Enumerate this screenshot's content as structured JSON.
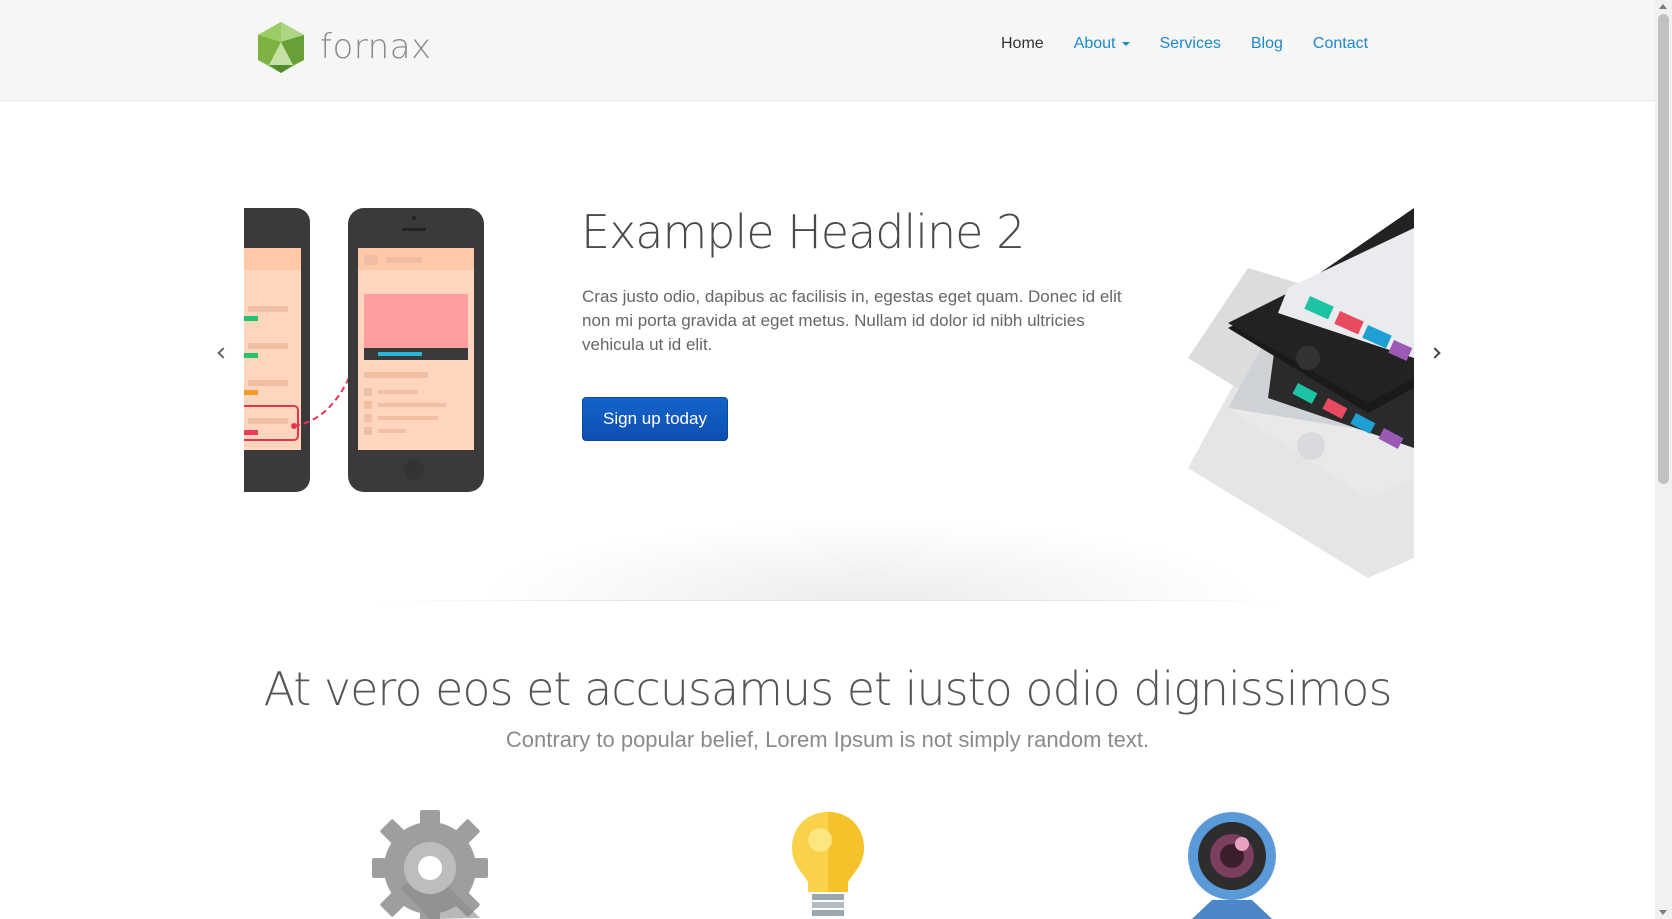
{
  "brand": {
    "name": "fornax"
  },
  "nav": {
    "items": [
      {
        "label": "Home",
        "active": true
      },
      {
        "label": "About",
        "dropdown": true
      },
      {
        "label": "Services"
      },
      {
        "label": "Blog"
      },
      {
        "label": "Contact"
      }
    ]
  },
  "hero": {
    "headline": "Example Headline 2",
    "lead": "Cras justo odio, dapibus ac facilisis in, egestas eget quam. Donec id elit non mi porta gravida at eget metus. Nullam id dolor id nibh ultricies vehicula ut id elit.",
    "cta_label": "Sign up today",
    "prev_icon": "chevron-left-icon",
    "next_icon": "chevron-right-icon"
  },
  "marketing": {
    "title": "At vero eos et accusamus et iusto odio dignissimos",
    "subtitle": "Contrary to popular belief, Lorem Ipsum is not simply random text.",
    "features": [
      {
        "icon": "gear-icon"
      },
      {
        "icon": "lightbulb-icon"
      },
      {
        "icon": "webcam-icon"
      }
    ]
  },
  "colors": {
    "link": "#1f88c7",
    "cta": "#1464c9",
    "logo_green": "#8bc34a"
  }
}
